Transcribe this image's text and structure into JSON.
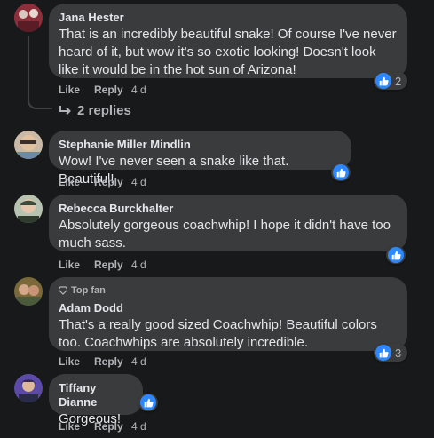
{
  "colors": {
    "background": "#18191a",
    "bubble": "#3a3b3c",
    "like_blue": "#2d88ff",
    "muted": "#b0b3b8",
    "text": "#e4e6eb"
  },
  "comments": [
    {
      "author": "Jana Hester",
      "text": "That is an incredibly beautiful snake! Of course I've never heard of it, but wow it's so exotic looking! Doesn't look like it would be in the hot sun of Arizona!",
      "like_label": "Like",
      "reply_label": "Reply",
      "time": "4 d",
      "reaction_count": "2"
    },
    {
      "author": "Stephanie Miller Mindlin",
      "text": "Wow! I've never seen a snake like that. Beautiful!",
      "like_label": "Like",
      "reply_label": "Reply",
      "time": "4 d"
    },
    {
      "author": "Rebecca Burckhalter",
      "text": "Absolutely gorgeous coachwhip! I hope it didn't have too much sass.",
      "like_label": "Like",
      "reply_label": "Reply",
      "time": "4 d"
    },
    {
      "badge": "Top fan",
      "author": "Adam Dodd",
      "text": "That's a really good sized Coachwhip! Beautiful colors too. Coachwhips are absolutely incredible.",
      "like_label": "Like",
      "reply_label": "Reply",
      "time": "4 d",
      "reaction_count": "3"
    },
    {
      "author": "Tiffany Dianne",
      "text": "Gorgeous!",
      "like_label": "Like",
      "reply_label": "Reply",
      "time": "4 d"
    }
  ],
  "replies_link": "2 replies"
}
